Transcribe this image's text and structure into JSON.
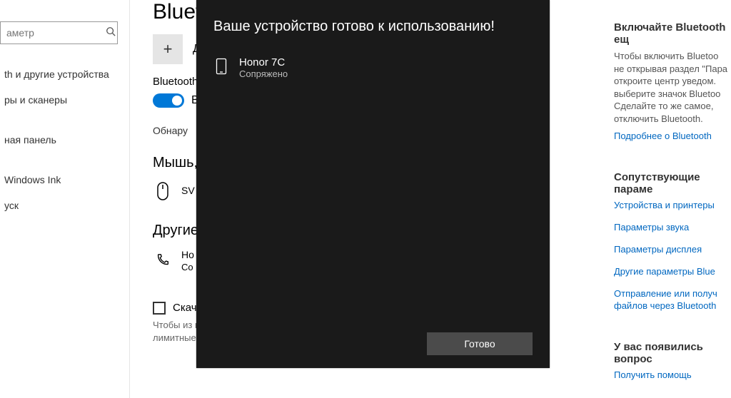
{
  "search": {
    "placeholder": "аметр"
  },
  "sidebar": {
    "items": [
      {
        "label": "th и другие устройства"
      },
      {
        "label": "ры и сканеры"
      },
      {
        "label": ""
      },
      {
        "label": "ная панель"
      },
      {
        "label": ""
      },
      {
        "label": "Windows Ink"
      },
      {
        "label": "уск"
      }
    ]
  },
  "page": {
    "title": "Bluetoot",
    "add_label": "Д",
    "bt_label": "Bluetooth",
    "toggle_text": "В",
    "discover": "Обнару",
    "h_mouse": "Мышь,",
    "mouse_name": "SV",
    "h_other": "Другие",
    "other_name": "Ho",
    "other_sub": "Co",
    "check_label": "Скач",
    "note": "Чтобы из параметр устройств не будут скачиваться через лимитные подключения к Интернету."
  },
  "info": {
    "h1": "Включайте Bluetooth ещ",
    "p1": "Чтобы включить Bluetoo не открывая раздел \"Пара откроите центр уведом. выберите значок Bluetoo Сделайте то же самое, отключить Bluetooth.",
    "link_more": "Подробнее о Bluetooth",
    "h2": "Сопутствующие параме",
    "links": [
      "Устройства и принтеры",
      "Параметры звука",
      "Параметры дисплея",
      "Другие параметры Blue",
      "Отправление или получ файлов через Bluetooth"
    ],
    "h3": "У вас появились вопрос",
    "link_help": "Получить помощь"
  },
  "dialog": {
    "title": "Ваше устройство готово к использованию!",
    "device_name": "Honor 7C",
    "device_status": "Сопряжено",
    "done": "Готово"
  }
}
